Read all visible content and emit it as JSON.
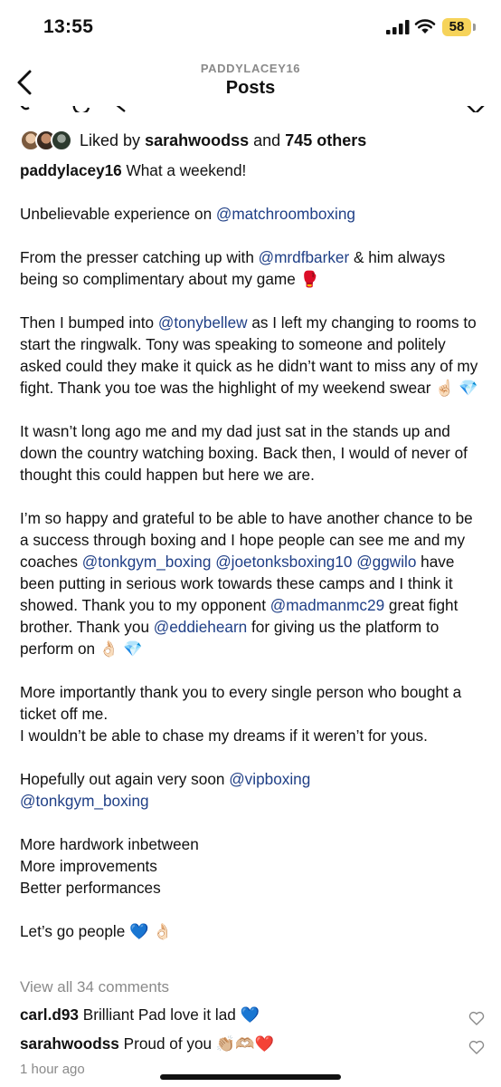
{
  "status_bar": {
    "time": "13:55",
    "battery": "58"
  },
  "header": {
    "subtitle": "PADDYLACEY16",
    "title": "Posts"
  },
  "likes": {
    "prefix": "Liked by",
    "user": "sarahwoodss",
    "joiner": "and",
    "count_text": "745 others"
  },
  "post": {
    "username": "paddylacey16",
    "caption_blocks": [
      [
        {
          "t": "user",
          "v": "paddylacey16"
        },
        {
          "t": "text",
          "v": " What a weekend!"
        }
      ],
      [
        {
          "t": "text",
          "v": "Unbelievable experience on "
        },
        {
          "t": "mention",
          "v": "@matchroomboxing"
        }
      ],
      [
        {
          "t": "text",
          "v": "From the presser catching up with "
        },
        {
          "t": "mention",
          "v": "@mrdfbarker"
        },
        {
          "t": "text",
          "v": " & him always being so complimentary about my game 🥊"
        }
      ],
      [
        {
          "t": "text",
          "v": "Then I bumped into "
        },
        {
          "t": "mention",
          "v": "@tonybellew"
        },
        {
          "t": "text",
          "v": " as I left my changing to rooms to start the ringwalk. Tony was speaking to someone and politely asked could they make it quick as he didn’t want to miss any of my fight. Thank you toe was the highlight of my weekend swear ☝🏻 💎"
        }
      ],
      [
        {
          "t": "text",
          "v": "It wasn’t long ago me and my dad just sat in the stands up and down the country watching boxing. Back then, I would of never of thought this could happen but here we are."
        }
      ],
      [
        {
          "t": "text",
          "v": "I’m so happy and grateful to be able to have another chance to be a success through boxing and I hope people can see me and my coaches "
        },
        {
          "t": "mention",
          "v": "@tonkgym_boxing"
        },
        {
          "t": "text",
          "v": " "
        },
        {
          "t": "mention",
          "v": "@joetonksboxing10"
        },
        {
          "t": "text",
          "v": " "
        },
        {
          "t": "mention",
          "v": "@ggwilo"
        },
        {
          "t": "text",
          "v": " have been putting in serious work towards these camps and I think it showed. Thank you to  my opponent "
        },
        {
          "t": "mention",
          "v": "@madmanmc29"
        },
        {
          "t": "text",
          "v": "  great fight brother. Thank you "
        },
        {
          "t": "mention",
          "v": "@eddiehearn"
        },
        {
          "t": "text",
          "v": " for giving us the platform to perform on 👌🏻 💎"
        }
      ],
      [
        {
          "t": "text",
          "v": "More importantly thank you to every single person who bought a ticket off me."
        },
        {
          "t": "br",
          "v": ""
        },
        {
          "t": "text",
          "v": "I wouldn’t be able to chase my dreams if it weren’t for yous."
        }
      ],
      [
        {
          "t": "text",
          "v": "Hopefully out again very soon "
        },
        {
          "t": "mention",
          "v": "@vipboxing"
        },
        {
          "t": "br",
          "v": ""
        },
        {
          "t": "mention",
          "v": "@tonkgym_boxing"
        }
      ],
      [
        {
          "t": "text",
          "v": "More hardwork inbetween"
        },
        {
          "t": "br",
          "v": ""
        },
        {
          "t": "text",
          "v": "More improvements"
        },
        {
          "t": "br",
          "v": ""
        },
        {
          "t": "text",
          "v": "Better performances"
        }
      ],
      [
        {
          "t": "text",
          "v": "Let’s go people 💙 👌🏻"
        }
      ]
    ]
  },
  "comments_link": "View all 34 comments",
  "comments": [
    {
      "user": "carl.d93",
      "text": "Brilliant Pad love it lad 💙"
    },
    {
      "user": "sarahwoodss",
      "text": "Proud of you 👏🏼🫶🏼❤️"
    }
  ],
  "timestamp": "1 hour ago",
  "colors": {
    "mention": "#1f3f86",
    "muted": "#8a8a8a",
    "battery": "#f6d35a"
  }
}
